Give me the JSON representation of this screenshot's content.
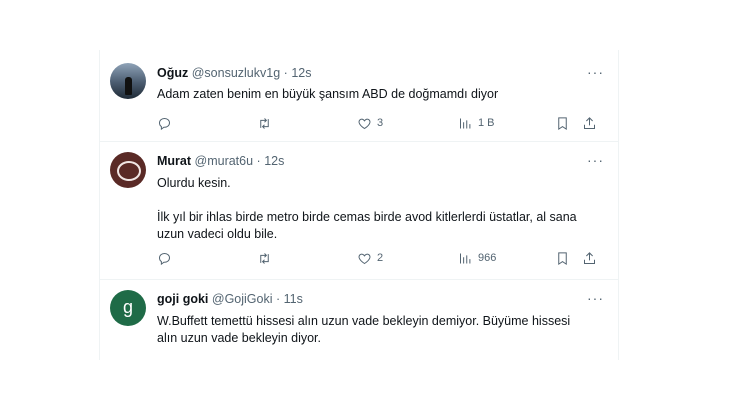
{
  "tweets": [
    {
      "name": "Oğuz",
      "handle": "@sonsuzlukv1g",
      "time": "12s",
      "text": "Adam zaten benim en büyük şansım ABD de doğmamdı diyor",
      "likes": "3",
      "views": "1 B",
      "avatar": "silhouette-avatar"
    },
    {
      "name": "Murat",
      "handle": "@murat6u",
      "time": "12s",
      "text": "Olurdu kesin.\n\nİlk yıl bir ihlas birde metro birde cemas birde avod kitlerlerdi üstatlar, al sana uzun vadeci oldu bile.",
      "likes": "2",
      "views": "966",
      "avatar": "ring-avatar"
    },
    {
      "name": "goji goki",
      "handle": "@GojiGoki",
      "time": "11s",
      "text": "W.Buffett temettü hissesi alın uzun vade bekleyin demiyor. Büyüme hissesi alın uzun vade bekleyin diyor.",
      "avatar_letter": "g",
      "avatar_color": "#1f6b47"
    }
  ],
  "icons": {
    "reply": "reply-icon",
    "retweet": "retweet-icon",
    "like": "heart-icon",
    "views": "views-icon",
    "bookmark": "bookmark-icon",
    "share": "share-icon",
    "more": "more-icon"
  },
  "more_glyph": "···"
}
